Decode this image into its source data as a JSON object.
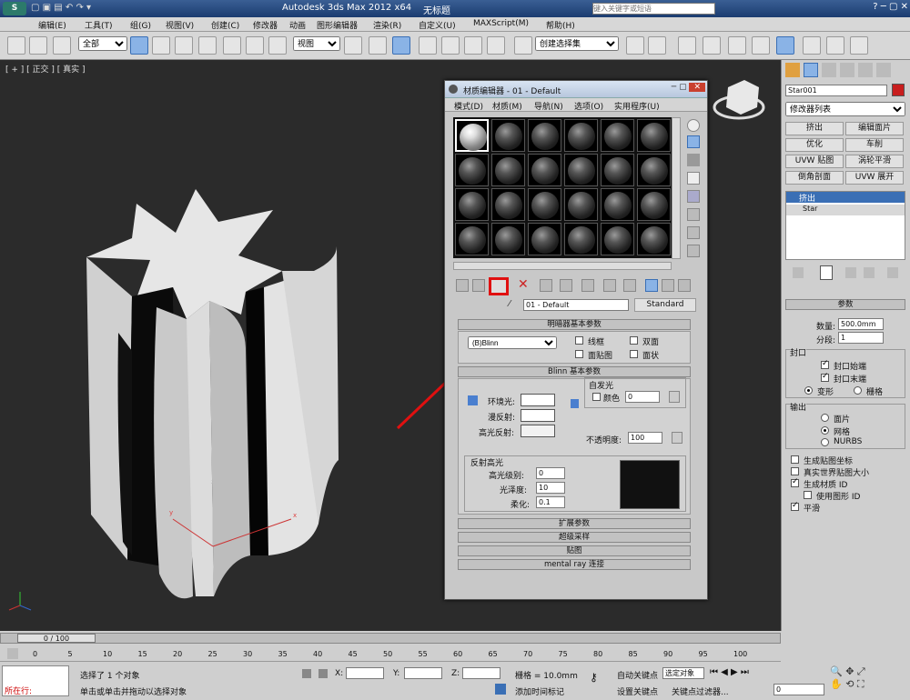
{
  "title": {
    "app": "Autodesk 3ds Max  2012 x64",
    "file": "无标题",
    "search_placeholder": "键入关键字或短语"
  },
  "menus": [
    "编辑(E)",
    "工具(T)",
    "组(G)",
    "视图(V)",
    "创建(C)",
    "修改器",
    "动画",
    "图形编辑器",
    "渲染(R)",
    "自定义(U)",
    "MAXScript(M)",
    "帮助(H)"
  ],
  "toolbar": {
    "selection_filter": "全部",
    "ref_coord": "视图",
    "named_sel": "创建选择集"
  },
  "viewport": {
    "label": "[ + ] [ 正交 ] [ 真实 ]"
  },
  "mat": {
    "title": "材质编辑器 - 01 - Default",
    "menus": [
      "模式(D)",
      "材质(M)",
      "导航(N)",
      "选项(O)",
      "实用程序(U)"
    ],
    "mat_name": "01 - Default",
    "mat_type": "Standard",
    "shader_roll": "明暗器基本参数",
    "shader": "(B)Blinn",
    "opts": [
      "线框",
      "双面",
      "面贴图",
      "面状"
    ],
    "blinn_roll": "Blinn 基本参数",
    "self_illum": "自发光",
    "color_label": "颜色",
    "color_val": "0",
    "ambient": "环境光:",
    "diffuse": "漫反射:",
    "specular": "高光反射:",
    "opacity_label": "不透明度:",
    "opacity_val": "100",
    "spec_group": "反射高光",
    "spec_level": "高光级别:",
    "spec_level_val": "0",
    "gloss": "光泽度:",
    "gloss_val": "10",
    "soften": "柔化:",
    "soften_val": "0.1",
    "rollouts": [
      "扩展参数",
      "超级采样",
      "贴图",
      "mental ray 连接"
    ]
  },
  "right": {
    "obj_name": "Star001",
    "mod_list": "修改器列表",
    "mod_buttons": [
      "挤出",
      "编辑面片",
      "优化",
      "车削",
      "UVW 贴图",
      "涡轮平滑",
      "倒角剖面",
      "UVW 展开"
    ],
    "stack": [
      "挤出",
      "Star"
    ],
    "params_title": "参数",
    "amount_label": "数量:",
    "amount": "500.0mm",
    "segs_label": "分段:",
    "segs": "1",
    "cap_group": "封口",
    "cap_start": "封口始端",
    "cap_end": "封口末端",
    "morph": "变形",
    "grid": "栅格",
    "output_group": "输出",
    "patch": "面片",
    "mesh": "网格",
    "nurbs": "NURBS",
    "gen_map": "生成贴图坐标",
    "real_world": "真实世界贴图大小",
    "gen_mat": "生成材质 ID",
    "use_shape": "使用图形 ID",
    "smooth": "平滑"
  },
  "timeline": {
    "frame": "0 / 100",
    "ticks": [
      "0",
      "5",
      "10",
      "15",
      "20",
      "25",
      "30",
      "35",
      "40",
      "45",
      "50",
      "55",
      "60",
      "65",
      "70",
      "75",
      "80",
      "85",
      "90",
      "95",
      "100"
    ]
  },
  "status": {
    "running": "所在行:",
    "sel": "选择了 1 个对象",
    "prompt": "单击或单击并拖动以选择对象",
    "x": "X:",
    "y": "Y:",
    "z": "Z:",
    "grid": "栅格 = 10.0mm",
    "add_time": "添加时间标记",
    "auto_key": "自动关键点",
    "set_key": "设置关键点",
    "sel_obj": "选定对象",
    "key_filter": "关键点过滤器...",
    "frame_val": "0"
  },
  "colors": {
    "accent": "#e01010",
    "viewport": "#2b2b2b",
    "panel": "#cfcfcf"
  }
}
